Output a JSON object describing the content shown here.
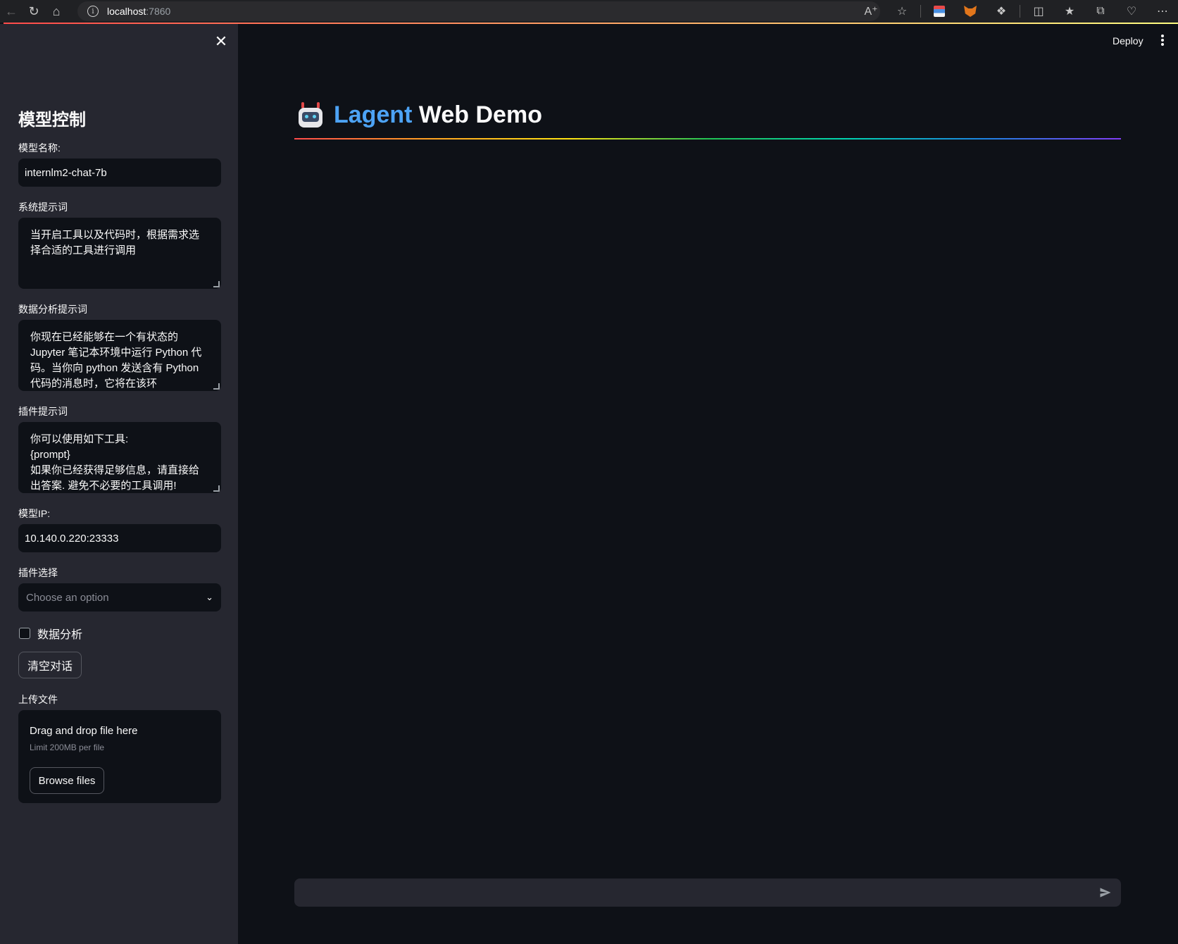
{
  "browser": {
    "url_host": "localhost",
    "url_port": ":7860"
  },
  "sidebar": {
    "title": "模型控制",
    "model_name": {
      "label": "模型名称:",
      "value": "internlm2-chat-7b"
    },
    "system_prompt": {
      "label": "系统提示词",
      "value": "当开启工具以及代码时，根据需求选择合适的工具进行调用"
    },
    "da_prompt": {
      "label": "数据分析提示词",
      "value": "你现在已经能够在一个有状态的 Jupyter 笔记本环境中运行 Python 代码。当你向 python 发送含有 Python 代码的消息时，它将在该环"
    },
    "plugin_prompt": {
      "label": "插件提示词",
      "value": "你可以使用如下工具:\n{prompt}\n如果你已经获得足够信息，请直接给出答案. 避免不必要的工具调用!"
    },
    "model_ip": {
      "label": "模型IP:",
      "value": "10.140.0.220:23333"
    },
    "plugin_select": {
      "label": "插件选择",
      "placeholder": "Choose an option"
    },
    "data_analysis_checkbox": {
      "label": "数据分析",
      "checked": false
    },
    "clear_button": "清空对话",
    "upload": {
      "label": "上传文件",
      "title": "Drag and drop file here",
      "limit": "Limit 200MB per file",
      "button": "Browse files"
    }
  },
  "main": {
    "deploy": "Deploy",
    "title_accent": "Lagent",
    "title_rest": "Web Demo",
    "chat_placeholder": ""
  },
  "colors": {
    "background": "#0e1117",
    "sidebar": "#262730",
    "title_accent": "#4da3f5"
  }
}
